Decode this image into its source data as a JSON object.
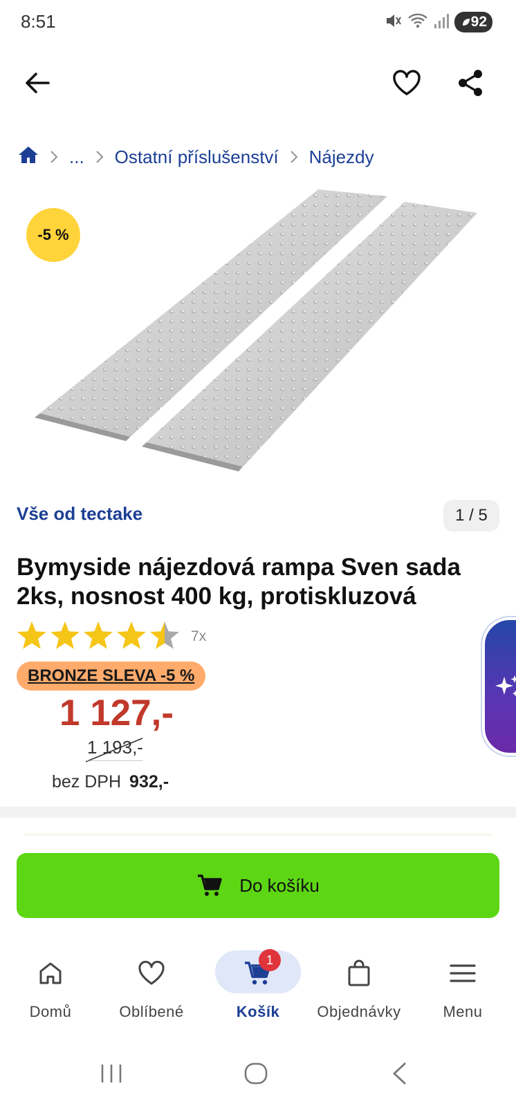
{
  "status_bar": {
    "time": "8:51",
    "battery": "92"
  },
  "breadcrumb": {
    "ellipsis": "...",
    "items": [
      "Ostatní příslušenství",
      "Nájezdy"
    ]
  },
  "gallery": {
    "discount_badge": "-5 %",
    "pager": "1 / 5"
  },
  "brand_link": "Vše od tectake",
  "product": {
    "title": "Bymyside nájezdová rampa Sven sada 2ks, nosnost 400 kg, protiskluzová",
    "rating": 4.5,
    "rating_max": 5,
    "rating_count": "7x",
    "bronze_label": "BRONZE SLEVA -5 %",
    "price": "1 127,-",
    "old_price": "1 193,-",
    "net_label": "bez DPH",
    "net_price": "932,-"
  },
  "cta": {
    "label": "Do košíku"
  },
  "bottom_nav": {
    "items": [
      {
        "label": "Domů",
        "icon": "home-icon"
      },
      {
        "label": "Oblíbené",
        "icon": "heart-icon"
      },
      {
        "label": "Košík",
        "icon": "cart-icon",
        "badge": "1"
      },
      {
        "label": "Objednávky",
        "icon": "bag-icon"
      },
      {
        "label": "Menu",
        "icon": "menu-icon"
      }
    ],
    "active": "Košík"
  },
  "colors": {
    "brand_blue": "#1c3f94",
    "price_red": "#c0392b",
    "cta_green": "#5dd614",
    "badge_yellow": "#ffd43b",
    "bronze_orange": "#ffab6b",
    "star_yellow": "#f5c518"
  }
}
